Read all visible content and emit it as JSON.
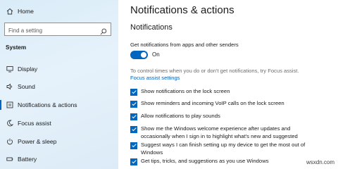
{
  "sidebar": {
    "home_label": "Home",
    "search_placeholder": "Find a setting",
    "section_title": "System",
    "items": [
      {
        "label": "Display",
        "icon": "display-icon"
      },
      {
        "label": "Sound",
        "icon": "sound-icon"
      },
      {
        "label": "Notifications & actions",
        "icon": "notifications-icon",
        "active": true
      },
      {
        "label": "Focus assist",
        "icon": "moon-icon"
      },
      {
        "label": "Power & sleep",
        "icon": "power-icon"
      },
      {
        "label": "Battery",
        "icon": "battery-icon"
      }
    ]
  },
  "main": {
    "title": "Notifications & actions",
    "subtitle": "Notifications",
    "get_notifications_label": "Get notifications from apps and other senders",
    "toggle_state": "On",
    "focus_hint": "To control times when you do or don't get notifications, try Focus assist.",
    "focus_link": "Focus assist settings",
    "checkboxes": [
      {
        "label": "Show notifications on the lock screen",
        "checked": true
      },
      {
        "label": "Show reminders and incoming VoIP calls on the lock screen",
        "checked": true
      },
      {
        "label": "Allow notifications to play sounds",
        "checked": true
      },
      {
        "label": "Show me the Windows welcome experience after updates and occasionally when I sign in to highlight what's new and suggested",
        "checked": true
      },
      {
        "label": "Suggest ways I can finish setting up my device to get the most out of Windows",
        "checked": true
      },
      {
        "label": "Get tips, tricks, and suggestions as you use Windows",
        "checked": true
      }
    ]
  },
  "watermark": "wsxdn.com",
  "colors": {
    "accent": "#0067c0",
    "link": "#005fb8",
    "sidebar_bg": "#dfeef9"
  }
}
